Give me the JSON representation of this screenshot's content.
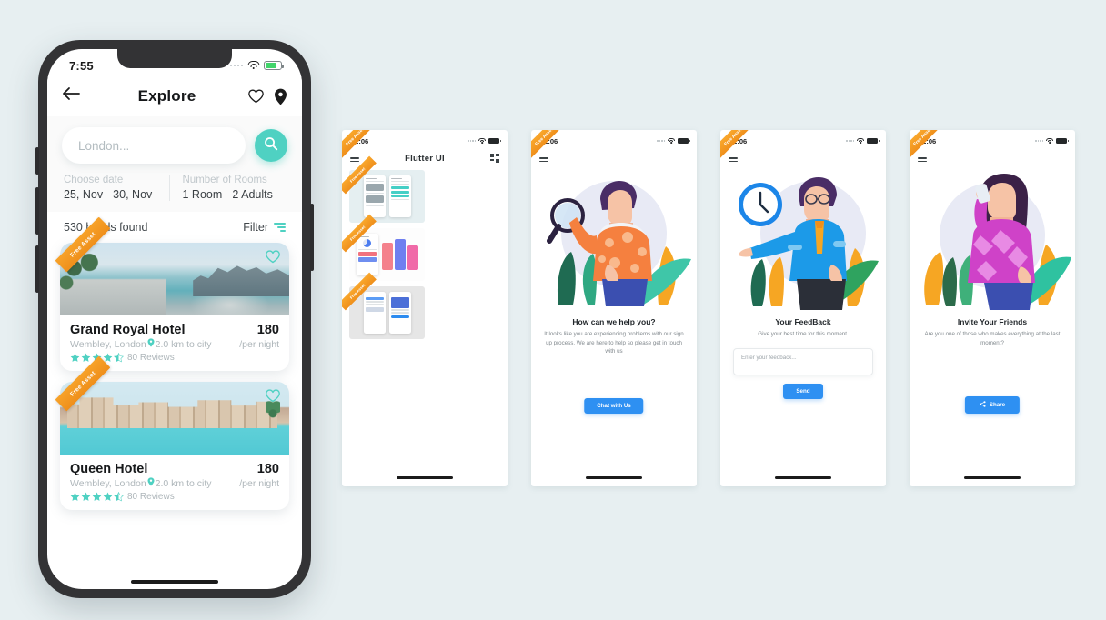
{
  "theme": {
    "background": "#e7eff1",
    "teal": "#4fd1c2",
    "blue": "#2e90f2",
    "orange": "#f29a21"
  },
  "big_phone": {
    "status": {
      "time": "7:55",
      "wifi_icon": "wifi-icon",
      "battery_icon": "battery-icon",
      "signal_icon": "signal-dots-icon"
    },
    "appbar": {
      "back_icon": "back-arrow-icon",
      "title": "Explore",
      "heart_icon": "heart-icon",
      "location_icon": "location-pin-icon"
    },
    "search": {
      "placeholder": "London...",
      "search_icon": "search-icon"
    },
    "fields": [
      {
        "label": "Choose date",
        "value": "25, Nov - 30, Nov"
      },
      {
        "label": "Number of Rooms",
        "value": "1 Room - 2 Adults"
      }
    ],
    "results": {
      "count_text": "530 hotels found",
      "filter_label": "Filter",
      "filter_icon": "filter-icon"
    },
    "hotels": [
      {
        "ribbon": "Free Asset",
        "name": "Grand Royal Hotel",
        "price": "180",
        "location": "Wembley, London",
        "distance": "2.0 km to city",
        "per": "/per night",
        "rating": 4.5,
        "reviews": "80 Reviews",
        "heart_icon": "heart-outline-icon",
        "pin_icon": "location-pin-icon"
      },
      {
        "ribbon": "Free Asset",
        "name": "Queen Hotel",
        "price": "180",
        "location": "Wembley, London",
        "distance": "2.0 km to city",
        "per": "/per night",
        "rating": 4.5,
        "reviews": "80 Reviews",
        "heart_icon": "heart-outline-icon",
        "pin_icon": "location-pin-icon"
      }
    ]
  },
  "mini_screens": [
    {
      "status_time": "12:06",
      "ribbon": "Free Asset",
      "menu_icon": "hamburger-menu-icon",
      "title": "Flutter UI",
      "grid_icon": "grid-view-icon",
      "thumbnails": [
        {
          "ribbon": "Free Asset",
          "name": "hotel-booking-ui"
        },
        {
          "ribbon": "Free Asset",
          "name": "fitness-dashboard-ui"
        },
        {
          "ribbon": "Free Asset",
          "name": "analytics-app-ui"
        }
      ]
    },
    {
      "status_time": "12:06",
      "ribbon": "Free Asset",
      "menu_icon": "hamburger-menu-icon",
      "illustration": "person-with-magnifier",
      "heading": "How can we help you?",
      "body": "It looks like you are experiencing problems with our sign up process. We are here to help so please get in touch with us",
      "button": "Chat with Us"
    },
    {
      "status_time": "12:06",
      "ribbon": "Free Asset",
      "menu_icon": "hamburger-menu-icon",
      "illustration": "person-with-clock",
      "heading": "Your FeedBack",
      "body": "Give your best time for this moment.",
      "input_placeholder": "Enter your feedback...",
      "button": "Send"
    },
    {
      "status_time": "12:06",
      "ribbon": "Free Asset",
      "menu_icon": "hamburger-menu-icon",
      "illustration": "woman-on-phone",
      "heading": "Invite Your Friends",
      "body": "Are you one of those who makes everything at the last moment?",
      "button": "Share",
      "button_icon": "share-icon"
    }
  ]
}
